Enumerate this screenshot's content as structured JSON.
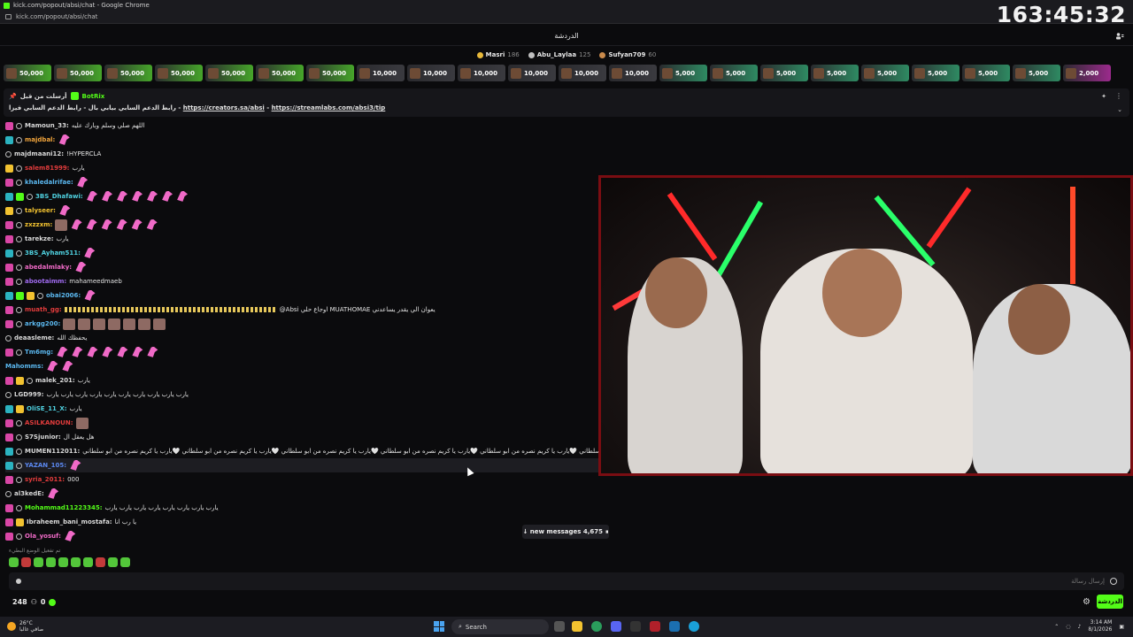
{
  "window": {
    "title": "kick.com/popout/absi/chat - Google Chrome",
    "url": "kick.com/popout/absi/chat"
  },
  "overlay_clock": "163:45:32",
  "chat_header": {
    "title": "الدردشة"
  },
  "leaderboard": [
    {
      "name": "Masri",
      "score": "186",
      "color": "#e8b93a"
    },
    {
      "name": "Abu_Laylaa",
      "score": "125",
      "color": "#c0c0c0"
    },
    {
      "name": "Sufyan709",
      "score": "60",
      "color": "#c98a4b"
    }
  ],
  "gifts": [
    {
      "amount": "50,000",
      "color": "#46a52a"
    },
    {
      "amount": "50,000",
      "color": "#46a52a"
    },
    {
      "amount": "50,000",
      "color": "#46a52a"
    },
    {
      "amount": "50,000",
      "color": "#46a52a"
    },
    {
      "amount": "50,000",
      "color": "#46a52a"
    },
    {
      "amount": "50,000",
      "color": "#46a52a"
    },
    {
      "amount": "50,000",
      "color": "#46a52a"
    },
    {
      "amount": "10,000",
      "color": "#3a3a3f"
    },
    {
      "amount": "10,000",
      "color": "#3a3a3f"
    },
    {
      "amount": "10,000",
      "color": "#3a3a3f"
    },
    {
      "amount": "10,000",
      "color": "#3a3a3f"
    },
    {
      "amount": "10,000",
      "color": "#3a3a3f"
    },
    {
      "amount": "10,000",
      "color": "#3a3a3f"
    },
    {
      "amount": "5,000",
      "color": "#2e8a62"
    },
    {
      "amount": "5,000",
      "color": "#2e8a62"
    },
    {
      "amount": "5,000",
      "color": "#2e8a62"
    },
    {
      "amount": "5,000",
      "color": "#2e8a62"
    },
    {
      "amount": "5,000",
      "color": "#2e8a62"
    },
    {
      "amount": "5,000",
      "color": "#2e8a62"
    },
    {
      "amount": "5,000",
      "color": "#2e8a62"
    },
    {
      "amount": "5,000",
      "color": "#2e8a62"
    },
    {
      "amount": "2,000",
      "color": "#9b2a8c"
    }
  ],
  "pinned": {
    "author_prefix": "أرسلت من قبل",
    "author": "BotRix",
    "text_prefix": "رابط الدعم السابي بيابي بال - رابط الدعم السابي فيزا -",
    "link1": "https://creators.sa/absi",
    "link2": "https://streamlabs.com/absi3/tip"
  },
  "messages": [
    {
      "user": "Mamoun_33",
      "color": "#d9d9d9",
      "badges": [
        "sub",
        "moon"
      ],
      "text": "اللهم صلي وسلم وبارك عليه",
      "emotes": 0
    },
    {
      "user": "majdbal",
      "color": "#f2a53c",
      "badges": [
        "tw",
        "moon"
      ],
      "text": "",
      "emotes": 1
    },
    {
      "user": "majdmaani12",
      "color": "#d9d9d9",
      "badges": [
        "moon"
      ],
      "text": "!HYPERCLA",
      "emotes": 0
    },
    {
      "user": "salem81999",
      "color": "#e23c3c",
      "badges": [
        "gold",
        "moon"
      ],
      "text": "يارب",
      "emotes": 0
    },
    {
      "user": "khaledalrifae",
      "color": "#5bb8f0",
      "badges": [
        "sub",
        "moon"
      ],
      "text": "",
      "emotes": 1
    },
    {
      "user": "3BS_Dhafawi",
      "color": "#4fd1e0",
      "badges": [
        "tw",
        "green",
        "moon"
      ],
      "text": "",
      "emotes": 7
    },
    {
      "user": "talyseer",
      "color": "#f2c230",
      "badges": [
        "gold",
        "moon"
      ],
      "text": "",
      "emotes": 1
    },
    {
      "user": "zxzzxm",
      "color": "#f2c230",
      "badges": [
        "sub",
        "moon"
      ],
      "text": "",
      "emotes": 6
    },
    {
      "user": "tarekze",
      "color": "#d9d9d9",
      "badges": [
        "sub",
        "moon"
      ],
      "text": "يارب",
      "emotes": 0
    },
    {
      "user": "3BS_Ayham511",
      "color": "#4fd1e0",
      "badges": [
        "tw",
        "moon"
      ],
      "text": "",
      "emotes": 1
    },
    {
      "user": "abedalmlaky",
      "color": "#f06ac7",
      "badges": [
        "sub",
        "moon"
      ],
      "text": "",
      "emotes": 1
    },
    {
      "user": "abootaimm",
      "color": "#a06bf0",
      "badges": [
        "sub",
        "moon"
      ],
      "text": "mahameedmaeb",
      "emotes": 0
    },
    {
      "user": "obai2006",
      "color": "#5bb8f0",
      "badges": [
        "tw",
        "green",
        "gold",
        "moon"
      ],
      "text": "",
      "emotes": 1
    },
    {
      "user": "muath_gg",
      "color": "#e23c3c",
      "badges": [
        "sub",
        "moon"
      ],
      "text": "@Absi اوجاع حلي MUATHOMAE يعوان الي يقدر يساعدني",
      "emotes": 0
    },
    {
      "user": "arkgg200",
      "color": "#5bb8f0",
      "badges": [
        "sub",
        "moon"
      ],
      "text": "",
      "emotes": 0
    },
    {
      "user": "deaasleme",
      "color": "#d9d9d9",
      "badges": [
        "moon"
      ],
      "text": "يحفظك الله",
      "emotes": 0
    },
    {
      "user": "Tm6mg",
      "color": "#5bb8f0",
      "badges": [
        "sub",
        "moon"
      ],
      "text": "",
      "emotes": 7
    },
    {
      "user": "Mahomms",
      "color": "#5bb8f0",
      "badges": [],
      "text": "",
      "emotes": 2
    },
    {
      "user": "malek_201",
      "color": "#d9d9d9",
      "badges": [
        "sub",
        "gold",
        "moon"
      ],
      "text": "يارب",
      "emotes": 0
    },
    {
      "user": "LGD999",
      "color": "#d9d9d9",
      "badges": [
        "moon"
      ],
      "text": "يارب يارب يارب يارب يارب يارب يارب يارب يارب يارب",
      "emotes": 0
    },
    {
      "user": "OliSE_11_X",
      "color": "#4fd1e0",
      "badges": [
        "tw",
        "gold"
      ],
      "text": "يارب",
      "emotes": 0
    },
    {
      "user": "ASILKANOUN",
      "color": "#e23c3c",
      "badges": [
        "sub",
        "moon"
      ],
      "text": "",
      "emotes": 0
    },
    {
      "user": "S7Sjunior",
      "color": "#d9d9d9",
      "badges": [
        "sub",
        "moon"
      ],
      "text": "هل يعقل ال",
      "emotes": 0
    },
    {
      "user": "MUMEN112011",
      "color": "#d9d9d9",
      "badges": [
        "tw",
        "moon"
      ],
      "text": "نصره من ابو سلطاني 🤍يارب يا كريم نصره من ابو سلطاني 🤍يارب يا كريم نصره من ابو سلطاني 🤍يارب يا كريم نصره من ابو سلطاني 🤍يارب يا كريم نصره من ابو سلطاني 🤍يارب يا كريم نصره من ابو سلطاني",
      "emotes": 0
    },
    {
      "user": "YAZAN_105",
      "color": "#5b88f0",
      "badges": [
        "tw",
        "moon"
      ],
      "text": "",
      "emotes": 1,
      "highlight": true
    },
    {
      "user": "syria_2011",
      "color": "#e23c3c",
      "badges": [
        "sub",
        "moon"
      ],
      "text": "000",
      "emotes": 0
    },
    {
      "user": "al3kedE",
      "color": "#d9d9d9",
      "badges": [
        "moon"
      ],
      "text": "",
      "emotes": 1
    },
    {
      "user": "Mohammad11223345",
      "color": "#53fc18",
      "badges": [
        "sub",
        "moon"
      ],
      "text": "يارب يارب يارب يارب يارب يارب يارب يارب",
      "emotes": 0
    },
    {
      "user": "Ibraheem_bani_mostafa",
      "color": "#d9d9d9",
      "badges": [
        "sub",
        "gold"
      ],
      "text": "يا رب انا",
      "emotes": 0
    },
    {
      "user": "Ola_yosuf",
      "color": "#f06ac7",
      "badges": [
        "sub",
        "moon"
      ],
      "text": "",
      "emotes": 1
    }
  ],
  "new_messages": {
    "label": "↓ new messages 4,675",
    "pause": "⏸"
  },
  "hint": "تم تفعيل الوضع البطيء",
  "input": {
    "placeholder": "إرسال رسالة"
  },
  "footer": {
    "viewers": "248",
    "points": "0",
    "send_label": "الدردشة"
  },
  "taskbar": {
    "weather_temp": "26°C",
    "weather_desc": "صافي غالبا",
    "search_label": "Search",
    "time": "3:14 AM",
    "date": "8/1/2026"
  }
}
